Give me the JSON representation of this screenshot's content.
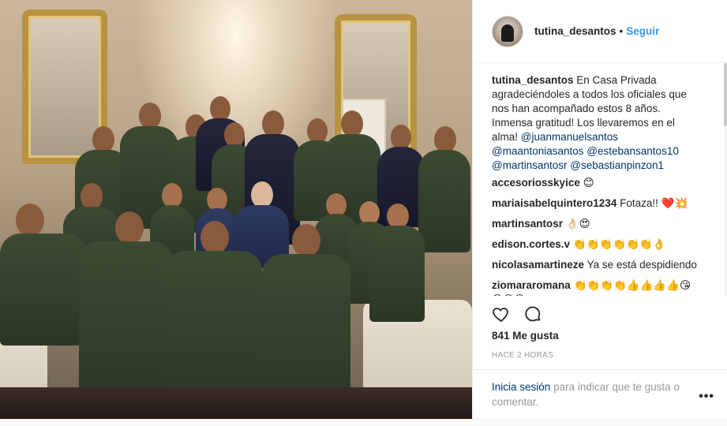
{
  "post": {
    "username": "tutina_desantos",
    "separator": "•",
    "follow_label": "Seguir",
    "caption": {
      "username": "tutina_desantos",
      "text": "En Casa Privada agradeciéndoles a todos los oficiales que nos han acompañado estos 8 años. Inmensa gratitud! Los llevaremos en el alma!",
      "mentions": [
        "@juanmanuelsantos",
        "@maantoniasantos",
        "@estebansantos10",
        "@martinsantosr",
        "@sebastianpinzon1"
      ]
    },
    "comments": [
      {
        "user": "accesoriosskyice",
        "text": "",
        "emoji": "😊"
      },
      {
        "user": "mariaisabelquintero1234",
        "text": "Fotaza!!",
        "emoji": "❤️💥"
      },
      {
        "user": "martinsantosr",
        "text": "",
        "emoji": "👌🏻😍"
      },
      {
        "user": "edison.cortes.v",
        "text": "",
        "emoji": "👏👏👏👏👏👏👌"
      },
      {
        "user": "nicolasamartineze",
        "text": "Ya se está despidiendo",
        "emoji": ""
      },
      {
        "user": "ziomararomana",
        "text": "",
        "emoji": "👏👏👏👏👍👍👍👍😘😉😉😉"
      }
    ],
    "likes_label": "841 Me gusta",
    "time_label": "HACE 2 HORAS",
    "login_link": "Inicia sesión",
    "login_text": "para indicar que te gusta o comentar.",
    "more_label": "•••"
  },
  "icons": {
    "like": "heart-icon",
    "comment": "comment-icon",
    "more": "more-options-icon"
  },
  "colors": {
    "link_blue": "#3897f0",
    "mention": "#003569",
    "muted": "#999999",
    "text": "#262626"
  }
}
